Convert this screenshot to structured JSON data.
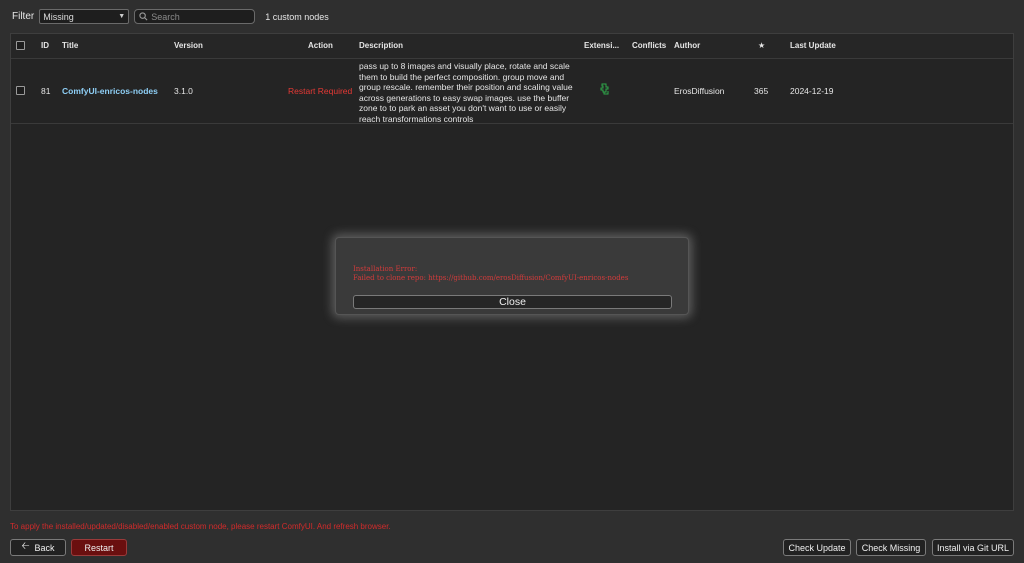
{
  "filter": {
    "label": "Filter",
    "selected": "Missing",
    "search_placeholder": "Search",
    "count_text": "1 custom nodes"
  },
  "table": {
    "headers": {
      "id": "ID",
      "title": "Title",
      "version": "Version",
      "action": "Action",
      "description": "Description",
      "extensions": "Extensi...",
      "conflicts": "Conflicts",
      "author": "Author",
      "stars": "★",
      "last_update": "Last Update"
    },
    "rows": [
      {
        "id": "81",
        "title": "ComfyUI-enricos-nodes",
        "version": "3.1.0",
        "action": "Restart Required",
        "description": "pass up to 8 images and visually place, rotate and scale them to build the perfect composition. group move and group rescale. remember their position and scaling value across generations to easy swap images. use the buffer zone to to park an asset you don't want to use or easily reach transformations controls",
        "extension_icon": "extension-icon",
        "conflicts": "",
        "author": "ErosDiffusion",
        "stars": "365",
        "last_update": "2024-12-19"
      }
    ]
  },
  "dialog": {
    "error_title": "Installation Error:",
    "error_message": "Failed to clone repo: https://github.com/erosDiffusion/ComfyUI-enricos-nodes",
    "close_label": "Close"
  },
  "footer": {
    "note": "To apply the installed/updated/disabled/enabled custom node, please restart ComfyUI. And refresh browser.",
    "back_label": "Back",
    "restart_label": "Restart",
    "check_update_label": "Check Update",
    "check_missing_label": "Check Missing",
    "install_git_label": "Install via Git URL"
  },
  "colors": {
    "background": "#2f2f2f",
    "title_link": "#8fd0f7",
    "error_red": "#d33b3b",
    "restart_button": "#6a0f0f",
    "extension_icon": "#2ea84a"
  }
}
